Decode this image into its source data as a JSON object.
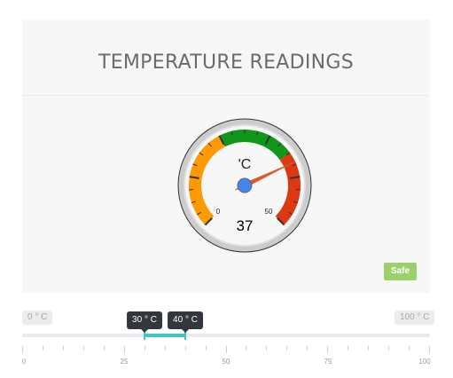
{
  "panel": {
    "title": "TEMPERATURE READINGS"
  },
  "gauge": {
    "unit": "'C",
    "min": 0,
    "max": 50,
    "value": 37,
    "min_label": "0",
    "max_label": "50",
    "value_label": "37",
    "bands": [
      {
        "from": 0,
        "to": 20,
        "color": "#ff9900"
      },
      {
        "from": 20,
        "to": 35,
        "color": "#109618"
      },
      {
        "from": 35,
        "to": 50,
        "color": "#dc3912"
      }
    ],
    "needle_color": "#e0582c",
    "hub_color": "#4684ee"
  },
  "status": {
    "badge": "Safe",
    "badge_color": "#9bd06a"
  },
  "slider": {
    "min_label": "0 ° C",
    "max_label": "100 ° C",
    "min": 0,
    "max": 100,
    "low": 30,
    "high": 40,
    "low_label": "30 ° C",
    "high_label": "40 ° C",
    "fill_color": "#3dc7c0",
    "scale_labels": [
      "0",
      "25",
      "50",
      "75",
      "100"
    ]
  }
}
